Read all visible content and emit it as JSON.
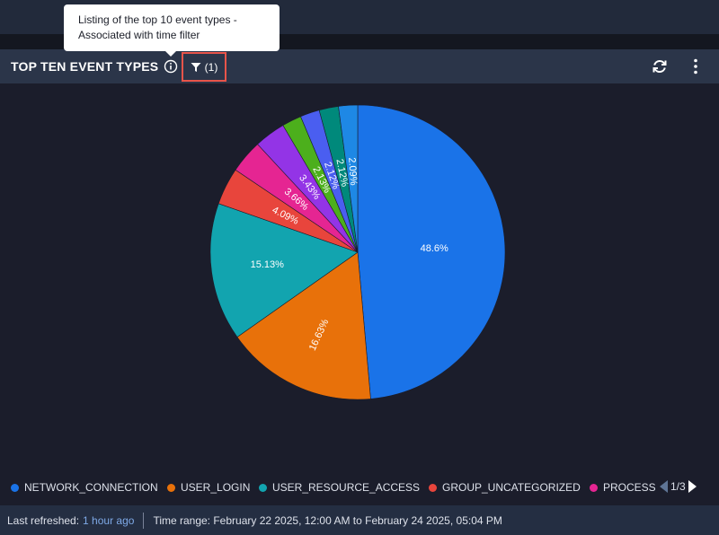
{
  "panel": {
    "title": "TOP TEN EVENT TYPES",
    "filter_count": "(1)",
    "tooltip_line1": "Listing of the top 10 event types -",
    "tooltip_line2": "Associated with time filter"
  },
  "chart_data": {
    "type": "pie",
    "values": [
      48.6,
      16.63,
      15.13,
      4.09,
      3.66,
      3.43,
      2.13,
      2.12,
      2.12,
      2.09
    ],
    "labels": [
      "48.6%",
      "16.63%",
      "15.13%",
      "4.09%",
      "3.66%",
      "3.43%",
      "2.13%",
      "2.12%",
      "2.12%",
      "2.09%"
    ],
    "colors": [
      "#1a73e8",
      "#e8710a",
      "#12a4af",
      "#e8453c",
      "#e52592",
      "#9334e6",
      "#4caf1c",
      "#4a5ef0",
      "#00897b",
      "#1e88e5"
    ],
    "legend_visible": [
      "NETWORK_CONNECTION",
      "USER_LOGIN",
      "USER_RESOURCE_ACCESS",
      "GROUP_UNCATEGORIZED",
      "PROCESS"
    ],
    "legend_placement": "bottom"
  },
  "legend": {
    "page": "1/3"
  },
  "footer": {
    "refreshed_label": "Last refreshed:",
    "refreshed_value": "1 hour ago",
    "time_range": "Time range: February 22 2025, 12:00 AM to February 24 2025, 05:04 PM"
  },
  "icons": {
    "info": "info-icon",
    "filter": "filter-icon",
    "refresh": "refresh-icon",
    "more": "more-vertical-icon"
  }
}
